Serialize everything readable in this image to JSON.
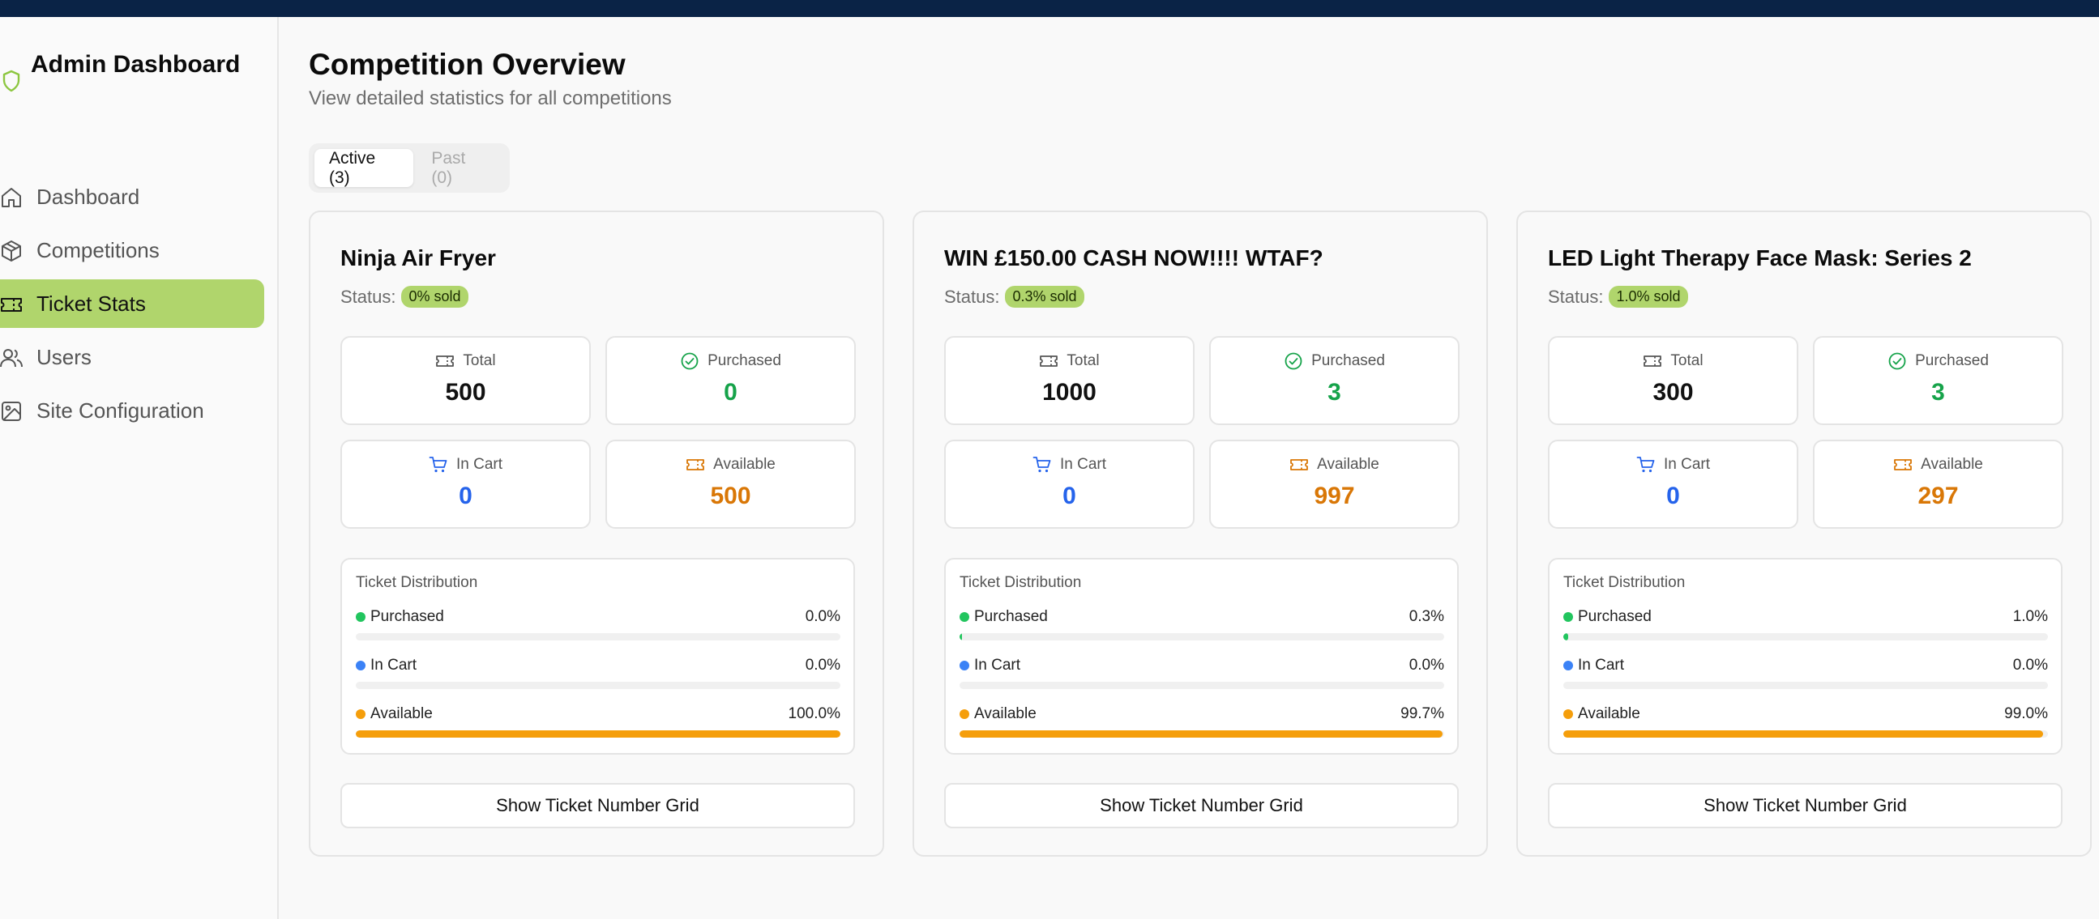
{
  "sidebar": {
    "brand": "Admin Dashboard",
    "items": [
      {
        "label": "Dashboard",
        "icon": "home-icon"
      },
      {
        "label": "Competitions",
        "icon": "box-icon"
      },
      {
        "label": "Ticket Stats",
        "icon": "ticket-icon",
        "active": true
      },
      {
        "label": "Users",
        "icon": "users-icon"
      },
      {
        "label": "Site Configuration",
        "icon": "image-icon"
      }
    ]
  },
  "header": {
    "title": "Competition Overview",
    "subtitle": "View detailed statistics for all competitions"
  },
  "tabs": [
    {
      "label": "Active (3)",
      "active": true
    },
    {
      "label": "Past (0)",
      "active": false
    }
  ],
  "labels": {
    "status": "Status:",
    "total": "Total",
    "purchased": "Purchased",
    "in_cart": "In Cart",
    "available": "Available",
    "distribution": "Ticket Distribution",
    "grid_button": "Show Ticket Number Grid"
  },
  "colors": {
    "accent": "#b0d56c",
    "topbar": "#0a2346",
    "purchased": "#22c55e",
    "in_cart": "#3b82f6",
    "available": "#f59e0b"
  },
  "competitions": [
    {
      "title": "Ninja Air Fryer",
      "badge": "0% sold",
      "total": "500",
      "purchased": "0",
      "in_cart": "0",
      "available": "500",
      "purchased_pct": "0.0%",
      "in_cart_pct": "0.0%",
      "available_pct": "100.0%",
      "purchased_frac": 0.0,
      "in_cart_frac": 0.0,
      "available_frac": 1.0
    },
    {
      "title": "WIN £150.00 CASH NOW!!!! WTAF?",
      "badge": "0.3% sold",
      "total": "1000",
      "purchased": "3",
      "in_cart": "0",
      "available": "997",
      "purchased_pct": "0.3%",
      "in_cart_pct": "0.0%",
      "available_pct": "99.7%",
      "purchased_frac": 0.003,
      "in_cart_frac": 0.0,
      "available_frac": 0.997
    },
    {
      "title": "LED Light Therapy Face Mask: Series 2",
      "badge": "1.0% sold",
      "total": "300",
      "purchased": "3",
      "in_cart": "0",
      "available": "297",
      "purchased_pct": "1.0%",
      "in_cart_pct": "0.0%",
      "available_pct": "99.0%",
      "purchased_frac": 0.01,
      "in_cart_frac": 0.0,
      "available_frac": 0.99
    }
  ]
}
